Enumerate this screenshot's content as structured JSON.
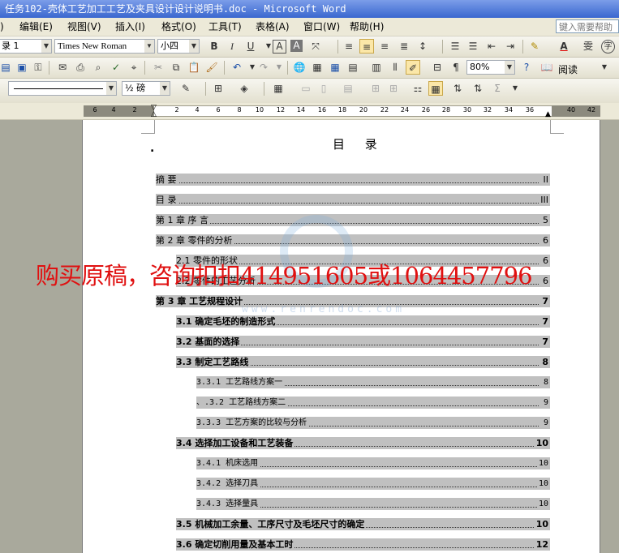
{
  "window": {
    "title": "任务102-壳体工艺加工工艺及夹具设计设计说明书.doc - Microsoft Word"
  },
  "menu": {
    "items": [
      "编辑(E)",
      "视图(V)",
      "插入(I)",
      "格式(O)",
      "工具(T)",
      "表格(A)",
      "窗口(W)",
      "帮助(H)"
    ],
    "help_placeholder": "键入需要帮助"
  },
  "formatting": {
    "style": "录 1",
    "font": "Times New Roman",
    "size": "小四",
    "bold": "B",
    "italic": "I",
    "underline": "U",
    "char_border": "A",
    "char_shading": "A",
    "font_color": "A",
    "phonetic": "雯",
    "enclose": "字"
  },
  "standard": {
    "zoom": "80%",
    "read_label": "阅读"
  },
  "drawing": {
    "line_weight": "½ 磅"
  },
  "ruler": {
    "ticks": [
      "6",
      "4",
      "2",
      "2",
      "4",
      "6",
      "8",
      "10",
      "12",
      "14",
      "16",
      "18",
      "20",
      "22",
      "24",
      "26",
      "28",
      "30",
      "32",
      "34",
      "36",
      "40",
      "42"
    ]
  },
  "document": {
    "heading": "目  录",
    "toc": [
      {
        "text": "摘  要",
        "page": "II",
        "level": 1,
        "bold": false
      },
      {
        "text": "目  录",
        "page": "III",
        "level": 1,
        "bold": false
      },
      {
        "text": "第 1 章  序     言",
        "page": "5",
        "level": 1,
        "bold": false
      },
      {
        "text": "第 2 章  零件的分析",
        "page": "6",
        "level": 1,
        "bold": false
      },
      {
        "text": "2.1 零件的形状",
        "page": "6",
        "level": 2,
        "bold": false
      },
      {
        "text": "2.2 零件的工艺分析",
        "page": "6",
        "level": 2,
        "bold": false
      },
      {
        "text": "第 3 章  工艺规程设计",
        "page": "7",
        "level": 1,
        "bold": true
      },
      {
        "text": "3.1  确定毛坯的制造形式",
        "page": "7",
        "level": 2,
        "bold": true
      },
      {
        "text": "3.2  基面的选择",
        "page": "7",
        "level": 2,
        "bold": true
      },
      {
        "text": "3.3  制定工艺路线",
        "page": "8",
        "level": 2,
        "bold": true
      },
      {
        "text": "3.3.1 工艺路线方案一",
        "page": "8",
        "level": 3,
        "bold": false
      },
      {
        "text": "、.3.2 工艺路线方案二",
        "page": "9",
        "level": 3,
        "bold": false
      },
      {
        "text": "3.3.3 工艺方案的比较与分析",
        "page": "9",
        "level": 3,
        "bold": false
      },
      {
        "text": "3.4  选择加工设备和工艺装备",
        "page": "10",
        "level": 2,
        "bold": true
      },
      {
        "text": "3.4.1 机床选用",
        "page": "10",
        "level": 3,
        "bold": false
      },
      {
        "text": "3.4.2 选择刀具",
        "page": "10",
        "level": 3,
        "bold": false
      },
      {
        "text": "3.4.3 选择量具",
        "page": "10",
        "level": 3,
        "bold": false
      },
      {
        "text": "3.5  机械加工余量、工序尺寸及毛坯尺寸的确定",
        "page": "10",
        "level": 2,
        "bold": true
      },
      {
        "text": "3.6 确定切削用量及基本工时",
        "page": "12",
        "level": 2,
        "bold": true
      }
    ],
    "watermark_text": "购买原稿，咨询扣扣414951605或1064457796",
    "watermark_site": "www.renrendoc.com"
  }
}
